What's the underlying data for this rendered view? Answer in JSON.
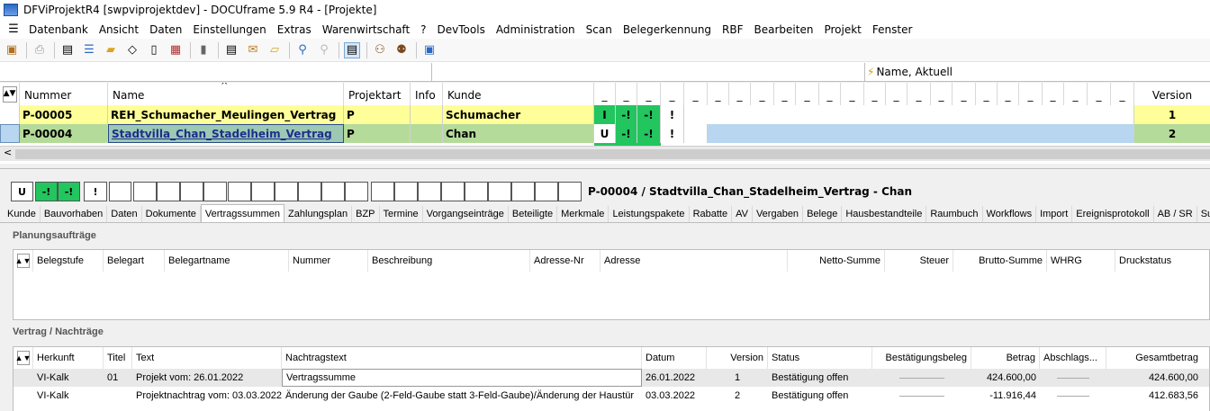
{
  "window": {
    "title": "DFViProjektR4 [swpviprojektdev] - DOCUframe 5.9 R4 - [Projekte]"
  },
  "menu": [
    "Datenbank",
    "Ansicht",
    "Daten",
    "Einstellungen",
    "Extras",
    "Warenwirtschaft",
    "?",
    "DevTools",
    "Administration",
    "Scan",
    "Belegerkennung",
    "RBF",
    "Bearbeiten",
    "Projekt",
    "Fenster"
  ],
  "filter": {
    "sort_label": "Name, Aktuell"
  },
  "projects": {
    "headers": {
      "nummer": "Nummer",
      "name": "Name",
      "art": "Projektart",
      "info": "Info",
      "kunde": "Kunde",
      "flag": "_",
      "version": "Version"
    },
    "rows": [
      {
        "nummer": "P-00005",
        "name": "REH_Schumacher_Meulingen_Vertrag",
        "art": "P",
        "info": "",
        "kunde": "Schumacher",
        "s1": "I",
        "s2": "-!",
        "s3": "-!",
        "s4": "!",
        "version": "1"
      },
      {
        "nummer": "P-00004",
        "name": "Stadtvilla_Chan_Stadelheim_Vertrag",
        "art": "P",
        "info": "",
        "kunde": "Chan",
        "s1": "U",
        "s2": "-!",
        "s3": "-!",
        "s4": "!",
        "version": "2"
      }
    ]
  },
  "status_boxes": {
    "b1": "U",
    "b2": "-!",
    "b3": "-!",
    "b4": "!"
  },
  "headline": "P-00004 / Stadtvilla_Chan_Stadelheim_Vertrag - Chan",
  "tabs": [
    "Kunde",
    "Bauvorhaben",
    "Daten",
    "Dokumente",
    "Vertragssummen",
    "Zahlungsplan",
    "BZP",
    "Termine",
    "Vorgangseinträge",
    "Beteiligte",
    "Merkmale",
    "Leistungspakete",
    "Rabatte",
    "AV",
    "Vergaben",
    "Belege",
    "Hausbestandteile",
    "Raumbuch",
    "Workflows",
    "Import",
    "Ereignisprotokoll",
    "AB / SR",
    "Suche"
  ],
  "active_tab": "Vertragssummen",
  "planung": {
    "title": "Planungsaufträge",
    "headers": [
      "Belegstufe",
      "Belegart",
      "Belegartname",
      "Nummer",
      "Beschreibung",
      "Adresse-Nr",
      "Adresse",
      "Netto-Summe",
      "Steuer",
      "Brutto-Summe",
      "WHRG",
      "Druckstatus"
    ]
  },
  "vertrag": {
    "title": "Vertrag / Nachträge",
    "headers": {
      "herkunft": "Herkunft",
      "titel": "Titel",
      "text": "Text",
      "nachtragstext": "Nachtragstext",
      "datum": "Datum",
      "version": "Version",
      "status": "Status",
      "beleg": "Bestätigungsbeleg",
      "betrag": "Betrag",
      "abschlag": "Abschlags...",
      "gesamt": "Gesamtbetrag"
    },
    "rows": [
      {
        "herkunft": "VI-Kalk",
        "titel": "01",
        "text": "Projekt vom: 26.01.2022",
        "nachtragstext": "Vertragssumme",
        "datum": "26.01.2022",
        "version": "1",
        "status": "Bestätigung offen",
        "betrag": "424.600,00",
        "gesamt": "424.600,00"
      },
      {
        "herkunft": "VI-Kalk",
        "titel": "",
        "text": "Projektnachtrag vom: 03.03.2022",
        "nachtragstext": "Änderung der Gaube (2-Feld-Gaube statt 3-Feld-Gaube)/Änderung der Haustür",
        "datum": "03.03.2022",
        "version": "2",
        "status": "Bestätigung offen",
        "betrag": "-11.916,44",
        "gesamt": "412.683,56"
      }
    ]
  },
  "colors": {
    "row_yellow": "#ffff99",
    "row_green": "#b5db9a",
    "row_blue": "#b8d6f0",
    "status_green": "#22c55e"
  }
}
